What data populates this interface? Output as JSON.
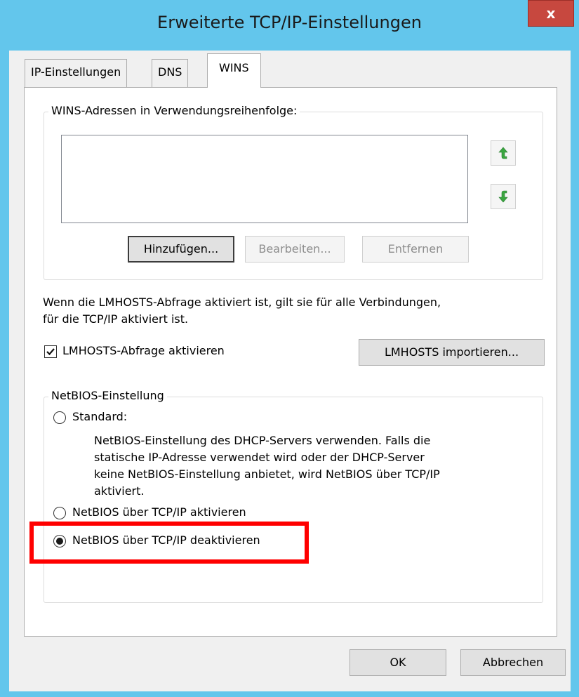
{
  "window": {
    "title": "Erweiterte TCP/IP-Einstellungen",
    "close_label": "x"
  },
  "tabs": [
    {
      "label": "IP-Einstellungen",
      "active": false
    },
    {
      "label": "DNS",
      "active": false
    },
    {
      "label": "WINS",
      "active": true
    }
  ],
  "wins": {
    "group_label": "WINS-Adressen in Verwendungsreihenfolge:",
    "move_up_icon": "arrow-up-icon",
    "move_down_icon": "arrow-down-icon",
    "add_label": "Hinzufügen...",
    "edit_label": "Bearbeiten...",
    "remove_label": "Entfernen"
  },
  "lmhosts": {
    "description": "Wenn die LMHOSTS-Abfrage aktiviert ist, gilt sie für alle Verbindungen,",
    "description2": "für die TCP/IP aktiviert ist.",
    "checkbox_label": "LMHOSTS-Abfrage aktivieren",
    "checked": true,
    "import_label": "LMHOSTS importieren..."
  },
  "netbios": {
    "group_label": "NetBIOS-Einstellung",
    "options": [
      {
        "label": "Standard:",
        "checked": false
      },
      {
        "label": "NetBIOS über TCP/IP aktivieren",
        "checked": false
      },
      {
        "label": "NetBIOS über TCP/IP deaktivieren",
        "checked": true
      }
    ],
    "standard_desc": [
      "NetBIOS-Einstellung des DHCP-Servers verwenden. Falls die",
      "statische IP-Adresse verwendet wird oder der DHCP-Server",
      "keine NetBIOS-Einstellung anbietet, wird NetBIOS über TCP/IP",
      "aktiviert."
    ]
  },
  "footer": {
    "ok_label": "OK",
    "cancel_label": "Abbrechen"
  },
  "colors": {
    "title_bar": "#63c6ec",
    "close_button": "#c7483f",
    "highlight": "#ff0000",
    "arrow_green": "#3aa640"
  }
}
